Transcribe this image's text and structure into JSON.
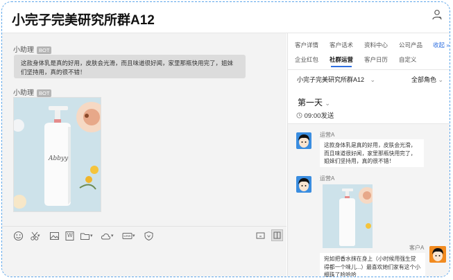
{
  "header": {
    "title": "小完子完美研究所群A12",
    "user_icon": "user-icon"
  },
  "chat": {
    "messages": [
      {
        "sender": "小助理",
        "badge": "BOT",
        "text": "这款身体乳是真的好用，皮肤会光滑，而且味道很好闻，家里那瓶快用完了，姐妹们坚持用，真的很不错！"
      },
      {
        "sender": "小助理",
        "badge": "BOT",
        "image": "product-photo",
        "product_label": "Abbyy"
      }
    ]
  },
  "toolbar": {
    "icons": [
      "emoji-icon",
      "scissors-icon",
      "image-icon",
      "word-doc-icon",
      "folder-icon",
      "cloud-icon",
      "link-icon",
      "shield-icon",
      "screen-icon",
      "panel-toggle-icon"
    ],
    "word_label": "W",
    "link_label": "LINK"
  },
  "right": {
    "tabs_row1": [
      "客户详情",
      "客户话术",
      "资料中心",
      "公司产品"
    ],
    "collapse_label": "收起",
    "tabs_row2": [
      "企业红包",
      "社群运营",
      "客户日历",
      "自定义"
    ],
    "active_tab": "社群运营",
    "filter_group": "小完子完美研究所群A12",
    "filter_role": "全部角色",
    "day_label": "第一天",
    "send_time": "09:00发送",
    "feed": [
      {
        "sender": "运营A",
        "text": "这款身体乳是真的好用，皮肤会光滑，而且味道很好闻，家里那瓶快用完了，姐妹们坚持用，真的很不错！"
      },
      {
        "sender": "运营A",
        "image": "product-photo"
      },
      {
        "sender": "客户A",
        "text": "宛如把香水抹在身上（小时候用强生觉得都一个味儿...）最喜欢她们家有这个小细珠了哈哈哈"
      }
    ]
  },
  "colors": {
    "accent": "#2f6fe0",
    "border": "#5ba5ea",
    "bot_badge": "#b5b5b5"
  }
}
